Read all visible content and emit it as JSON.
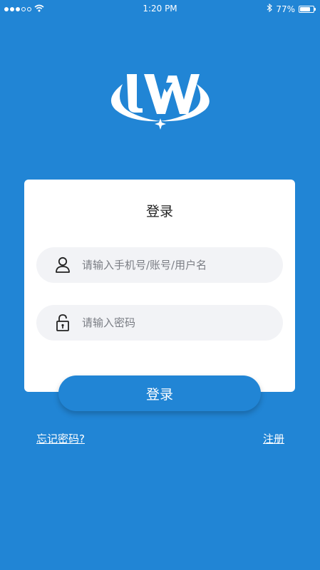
{
  "status_bar": {
    "time": "1:20 PM",
    "battery": "77%",
    "battery_level": 0.77,
    "signal_icon": "signal-dots-icon",
    "wifi_icon": "wifi-icon",
    "bluetooth_icon": "bluetooth-icon"
  },
  "logo": {
    "text": "LW",
    "icon": "lw-logo"
  },
  "login_card": {
    "title": "登录",
    "username_placeholder": "请输入手机号/账号/用户名",
    "password_placeholder": "请输入密码",
    "username_icon": "user-icon",
    "password_icon": "lock-icon"
  },
  "actions": {
    "login_label": "登录",
    "forgot_password": "忘记密码?",
    "register": "注册"
  },
  "colors": {
    "background": "#2185d5",
    "card": "#ffffff",
    "input_bg": "#f2f3f6",
    "button": "#2185d5"
  }
}
